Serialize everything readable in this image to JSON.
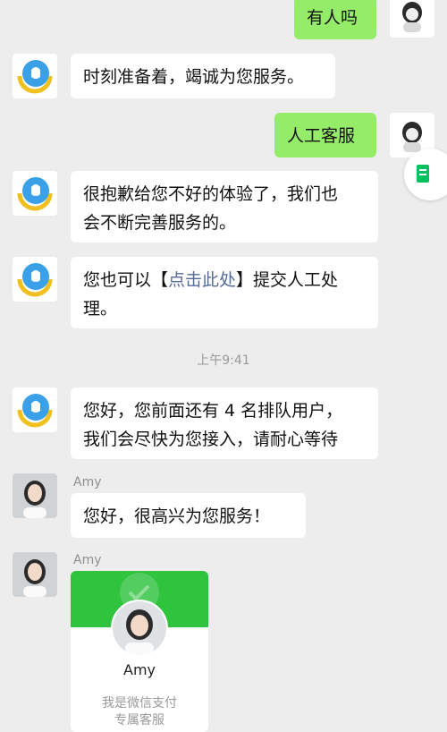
{
  "messages": {
    "m1": "有人吗",
    "m2": "时刻准备着，竭诚为您服务。",
    "m3": "人工客服",
    "m4_line1": "很抱歉给您不好的体验了，我们也",
    "m4_line2": "会不断完善服务的。",
    "m5_prefix": "您也可以【",
    "m5_link": "点击此处",
    "m5_suffix": "】提交人工处",
    "m5_line2": "理。",
    "m6_line1": "您好，您前面还有 4 名排队用户，",
    "m6_line2": "我们会尽快为您接入，请耐心等待",
    "m7": "您好，很高兴为您服务！"
  },
  "timestamp": "上午9:41",
  "agent": {
    "name1": "Amy",
    "name2": "Amy"
  },
  "card": {
    "name": "Amy",
    "sub_line1": "我是微信支付",
    "sub_line2": "专属客服"
  },
  "colors": {
    "bubble_self": "#95ec69",
    "bubble_other": "#ffffff",
    "link": "#576b95",
    "background": "#ededed",
    "card_header": "#2fc33e"
  },
  "icons": {
    "user_avatar": "robot-avatar-icon",
    "bot_avatar": "support-bot-avatar-icon",
    "float": "document-icon"
  }
}
